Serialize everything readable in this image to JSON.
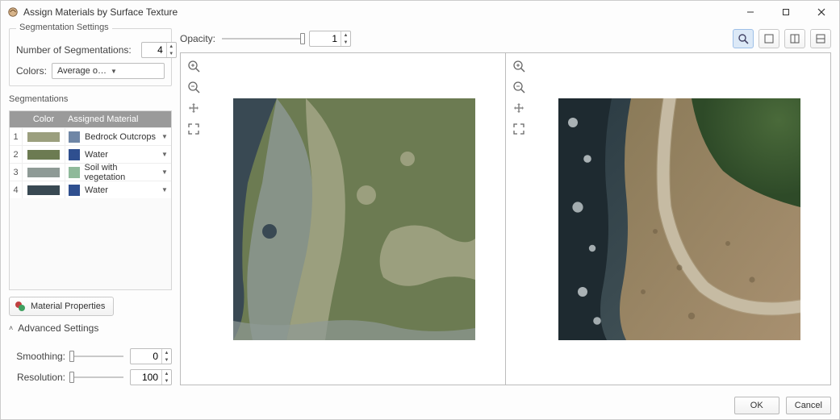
{
  "window": {
    "title": "Assign Materials by Surface Texture"
  },
  "segmentation_settings": {
    "legend": "Segmentation Settings",
    "num_label": "Number of Segmentations:",
    "num_value": "4",
    "colors_label": "Colors:",
    "colors_value": "Average of original image color"
  },
  "segmentations": {
    "label": "Segmentations",
    "head_color": "Color",
    "head_material": "Assigned Material",
    "rows": [
      {
        "idx": "1",
        "color": "#9b9f7e",
        "mat_color": "#6f86a6",
        "mat_name": "Bedrock Outcrops"
      },
      {
        "idx": "2",
        "color": "#6c7b52",
        "mat_color": "#2f4f8f",
        "mat_name": "Water"
      },
      {
        "idx": "3",
        "color": "#8e9a96",
        "mat_color": "#8fb99a",
        "mat_name": "Soil with vegetation"
      },
      {
        "idx": "4",
        "color": "#394953",
        "mat_color": "#2f4f8f",
        "mat_name": "Water"
      }
    ]
  },
  "material_properties_btn": "Material Properties",
  "advanced": {
    "title": "Advanced Settings",
    "smoothing_label": "Smoothing:",
    "smoothing_value": "0",
    "resolution_label": "Resolution:",
    "resolution_value": "100"
  },
  "opacity": {
    "label": "Opacity:",
    "value": "1"
  },
  "footer": {
    "ok": "OK",
    "cancel": "Cancel"
  },
  "view_tools": [
    "zoom-window",
    "single-view",
    "split-v",
    "split-h"
  ],
  "vp_tools": [
    "zoom-in",
    "zoom-out",
    "pan",
    "fit"
  ]
}
